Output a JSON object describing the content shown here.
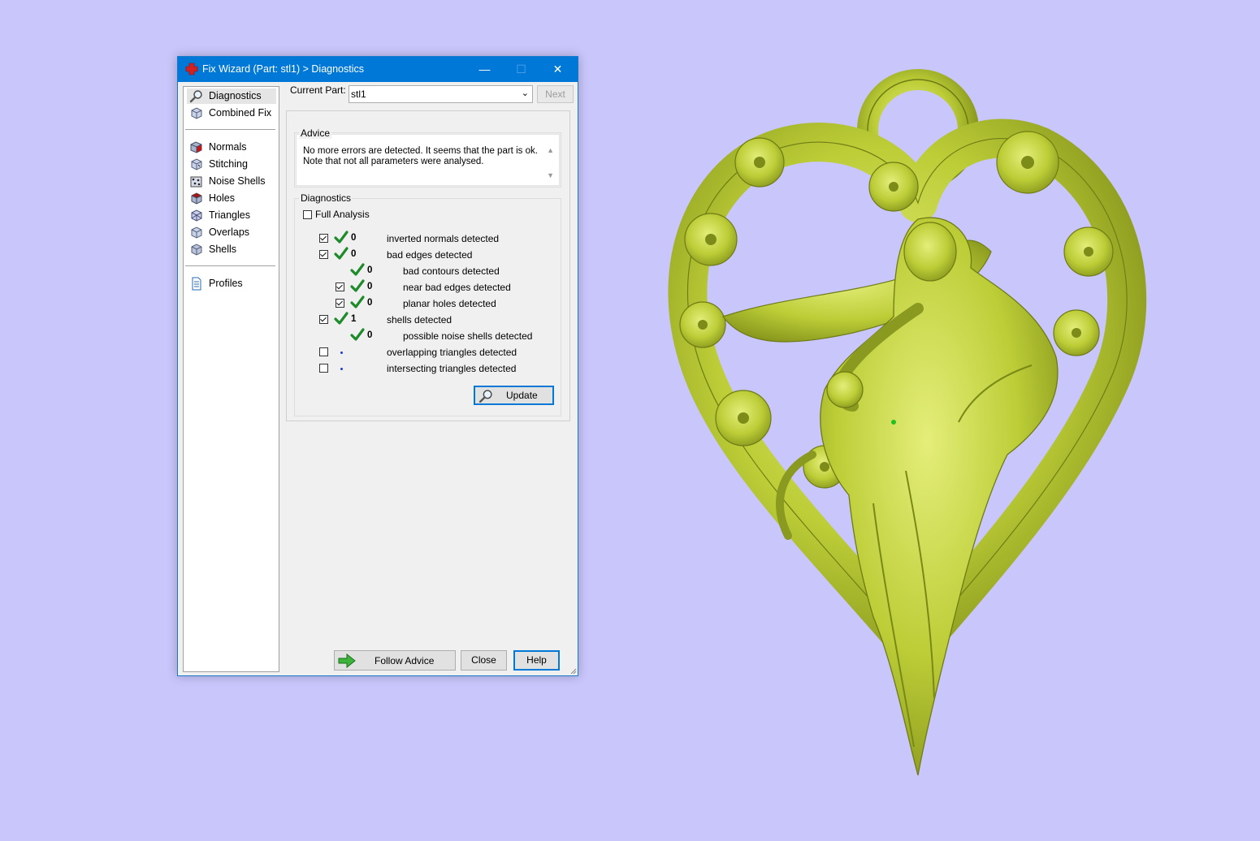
{
  "window": {
    "title": "Fix Wizard (Part: stl1) > Diagnostics",
    "minimize_glyph": "—",
    "maximize_glyph": "☐",
    "close_glyph": "✕"
  },
  "nav": {
    "items": [
      {
        "label": "Diagnostics",
        "icon": "magnifier-icon"
      },
      {
        "label": "Combined Fix",
        "icon": "cube-icon"
      },
      {
        "label": "Normals",
        "icon": "normals-cube-icon"
      },
      {
        "label": "Stitching",
        "icon": "stitching-cube-icon"
      },
      {
        "label": "Noise Shells",
        "icon": "noise-shells-icon"
      },
      {
        "label": "Holes",
        "icon": "holes-cube-icon"
      },
      {
        "label": "Triangles",
        "icon": "triangles-cube-icon"
      },
      {
        "label": "Overlaps",
        "icon": "overlaps-cube-icon"
      },
      {
        "label": "Shells",
        "icon": "shells-cube-icon"
      },
      {
        "label": "Profiles",
        "icon": "document-icon"
      }
    ]
  },
  "current_part": {
    "label": "Current Part:",
    "value": "stl1",
    "next_label": "Next"
  },
  "advice": {
    "title": "Advice",
    "line1": "No more errors are detected. It seems that the part is ok.",
    "line2": "Note that not all parameters were analysed."
  },
  "diagnostics": {
    "title": "Diagnostics",
    "full_analysis_label": "Full Analysis",
    "rows": [
      {
        "checkbox": "checked",
        "status": "ok",
        "count": "0",
        "label": "inverted normals detected"
      },
      {
        "checkbox": "checked",
        "status": "ok",
        "count": "0",
        "label": "bad edges detected"
      },
      {
        "checkbox": "none",
        "status": "ok",
        "count": "0",
        "label": "bad contours detected"
      },
      {
        "checkbox": "checked",
        "status": "ok",
        "count": "0",
        "label": "near bad edges detected"
      },
      {
        "checkbox": "checked",
        "status": "ok",
        "count": "0",
        "label": "planar holes detected"
      },
      {
        "checkbox": "checked",
        "status": "ok",
        "count": "1",
        "label": "shells detected"
      },
      {
        "checkbox": "none",
        "status": "ok",
        "count": "0",
        "label": "possible noise shells detected"
      },
      {
        "checkbox": "unchecked",
        "status": "not-analysed",
        "count": "",
        "label": "overlapping triangles detected"
      },
      {
        "checkbox": "unchecked",
        "status": "not-analysed",
        "count": "",
        "label": "intersecting triangles detected"
      }
    ],
    "update_label": "Update"
  },
  "footer": {
    "follow_advice_label": "Follow Advice",
    "close_label": "Close",
    "help_label": "Help"
  },
  "colors": {
    "desktop": "#c8c6fb",
    "titlebar": "#0078d7",
    "model": "#c4d43c",
    "tick": "#1e8a2a"
  },
  "viewport": {
    "model": "heart-shaped pendant with woman figure and flowers"
  }
}
